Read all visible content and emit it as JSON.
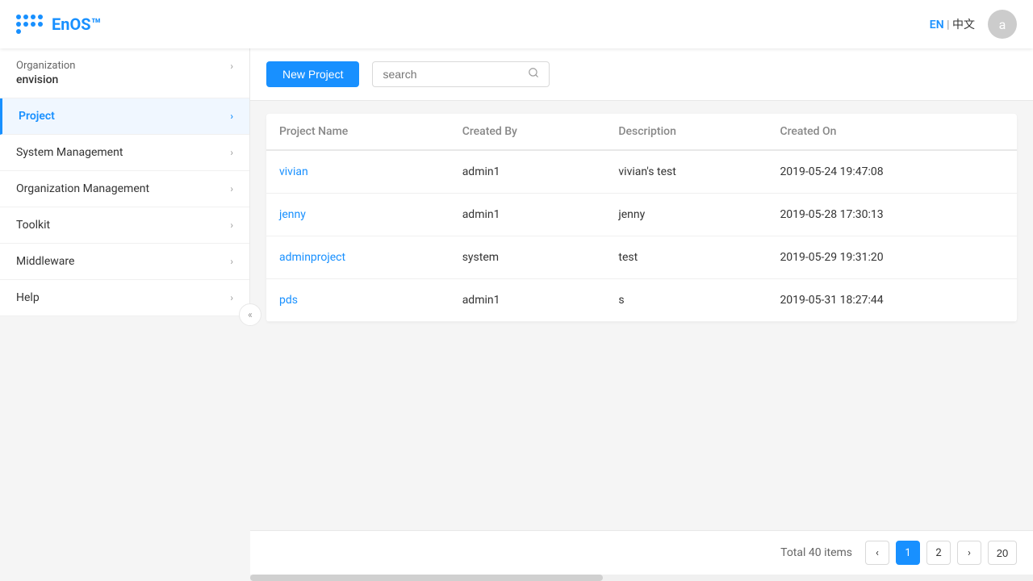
{
  "header": {
    "logo_text": "EnOS™",
    "lang_en": "EN",
    "lang_sep": "|",
    "lang_zh": "中文",
    "avatar_letter": "a"
  },
  "sidebar": {
    "org_label": "Organization",
    "org_name": "envision",
    "items": [
      {
        "id": "project",
        "label": "Project",
        "active": true
      },
      {
        "id": "system-management",
        "label": "System Management",
        "active": false
      },
      {
        "id": "organization-management",
        "label": "Organization Management",
        "active": false
      },
      {
        "id": "toolkit",
        "label": "Toolkit",
        "active": false
      },
      {
        "id": "middleware",
        "label": "Middleware",
        "active": false
      },
      {
        "id": "help",
        "label": "Help",
        "active": false
      }
    ]
  },
  "toolbar": {
    "new_project_label": "New Project",
    "search_placeholder": "search"
  },
  "table": {
    "columns": [
      {
        "id": "project-name",
        "label": "Project Name"
      },
      {
        "id": "created-by",
        "label": "Created By"
      },
      {
        "id": "description",
        "label": "Description"
      },
      {
        "id": "created-on",
        "label": "Created On"
      }
    ],
    "rows": [
      {
        "project_name": "vivian",
        "created_by": "admin1",
        "description": "vivian's test",
        "created_on": "2019-05-24 19:47:08"
      },
      {
        "project_name": "jenny",
        "created_by": "admin1",
        "description": "jenny",
        "created_on": "2019-05-28 17:30:13"
      },
      {
        "project_name": "adminproject",
        "created_by": "system",
        "description": "test",
        "created_on": "2019-05-29 19:31:20"
      },
      {
        "project_name": "pds",
        "created_by": "admin1",
        "description": "s",
        "created_on": "2019-05-31 18:27:44"
      }
    ]
  },
  "pagination": {
    "total_label": "Total 40 items",
    "current_page": 1,
    "pages": [
      1,
      2
    ],
    "page_size": "20"
  }
}
